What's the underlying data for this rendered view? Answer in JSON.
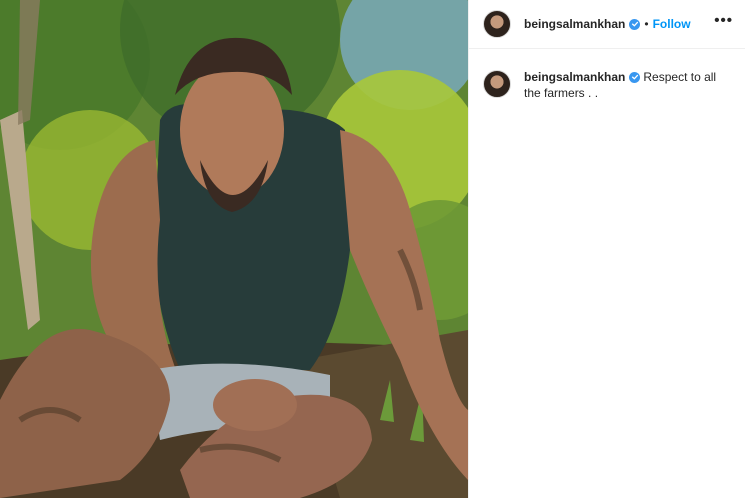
{
  "post": {
    "author": {
      "username": "beingsalmankhan",
      "verified_icon": "verified-badge-icon"
    },
    "header": {
      "separator": "•",
      "follow_label": "Follow",
      "more_icon": "more-options-icon",
      "more_label": "•••"
    },
    "caption": {
      "username": "beingsalmankhan",
      "text": "Respect to all the farmers . ."
    },
    "photo": {
      "subject": "post-photo"
    },
    "colors": {
      "accent": "#0095f6",
      "verified": "#3897f0",
      "text": "#262626",
      "border": "#efefef"
    }
  }
}
